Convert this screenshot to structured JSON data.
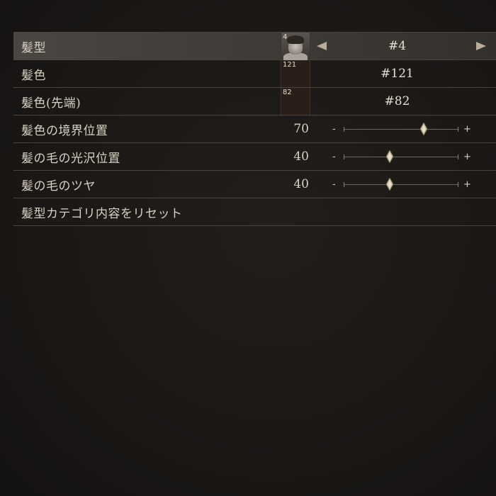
{
  "rows": [
    {
      "label": "髪型",
      "badge": "4",
      "value": "#4",
      "selected": true
    },
    {
      "label": "髪色",
      "badge": "121",
      "value": "#121"
    },
    {
      "label": "髪色(先端)",
      "badge": "82",
      "value": "#82"
    },
    {
      "label": "髪色の境界位置",
      "value": "70",
      "slider_fraction": 0.7
    },
    {
      "label": "髪の毛の光沢位置",
      "value": "40",
      "slider_fraction": 0.4
    },
    {
      "label": "髪の毛のツヤ",
      "value": "40",
      "slider_fraction": 0.4
    },
    {
      "label": "髪型カテゴリ内容をリセット"
    }
  ],
  "slider": {
    "minus": "-",
    "plus": "+"
  },
  "icons": {
    "prev": "arrow-left-icon",
    "next": "arrow-right-icon",
    "thumb": "diamond-thumb-icon"
  },
  "colors": {
    "swatch_121": "#2a1e19",
    "swatch_82": "#2a1e19",
    "accent": "#b9ae98"
  }
}
